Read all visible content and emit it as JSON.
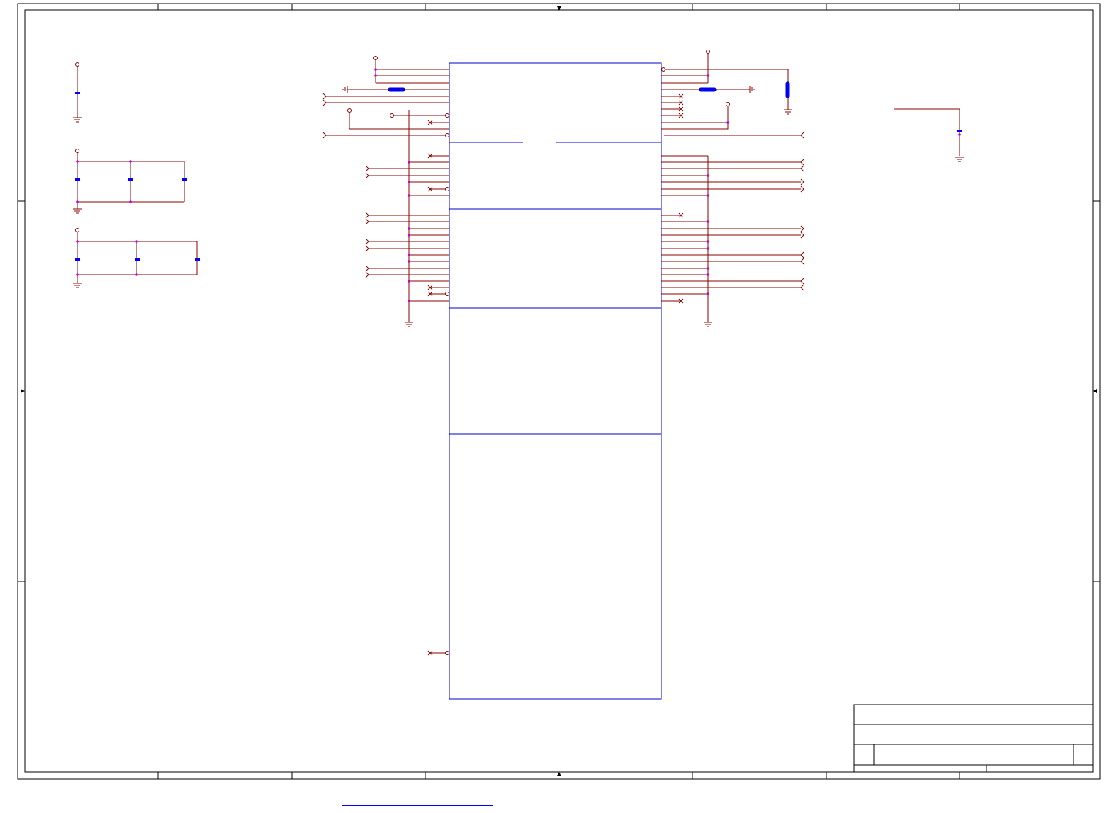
{
  "sheet": {
    "frame_color": "#000000",
    "wire_color": "#8b0000",
    "bus_color": "#800080",
    "junction_color": "#cc00cc",
    "part_color": "#0000cc",
    "capacitor_fill": "#0000ff"
  },
  "title_block": {},
  "footer_link": {
    "color": "#0000ff"
  }
}
